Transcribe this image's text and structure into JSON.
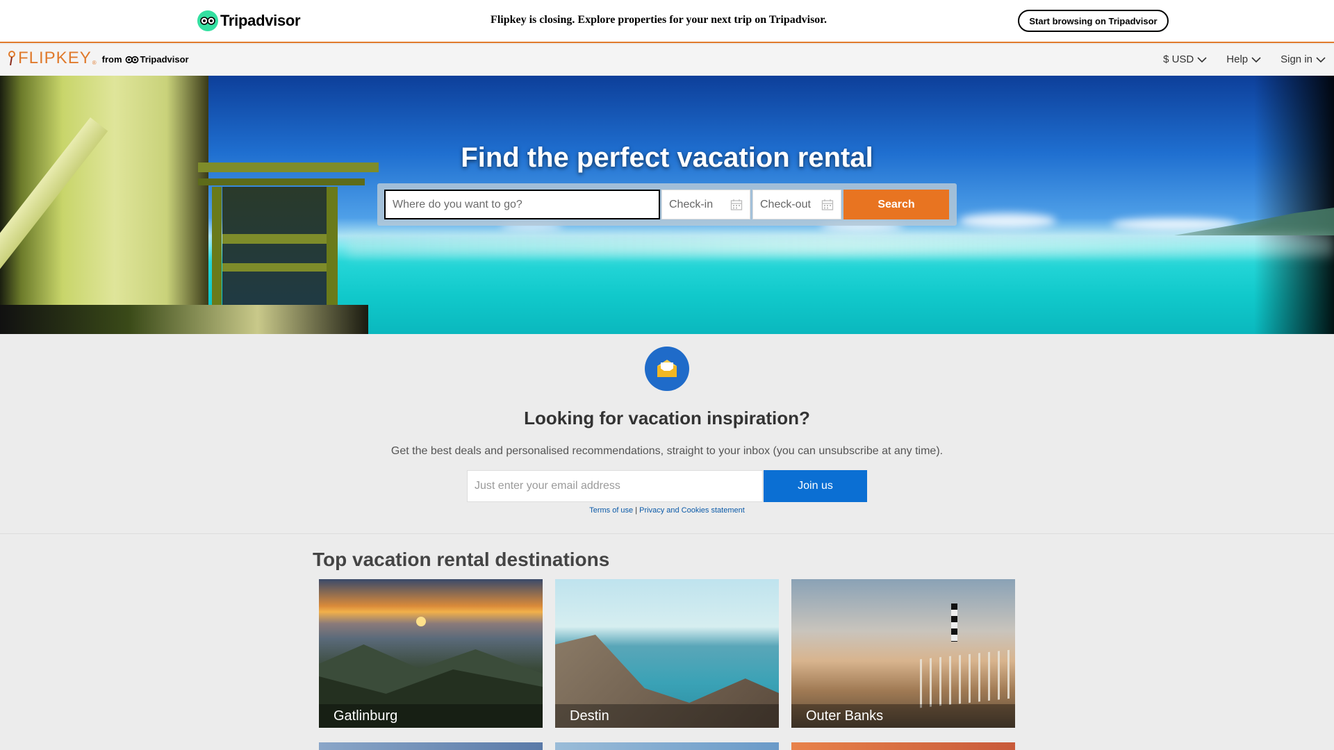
{
  "tripadvisor_banner": {
    "logo_text": "Tripadvisor",
    "message": "Flipkey is closing. Explore properties for your next trip on Tripadvisor.",
    "cta_label": "Start browsing on Tripadvisor"
  },
  "nav": {
    "logo_text": "FLIPKEY",
    "logo_reg": "®",
    "from_text": "from",
    "from_brand": "Tripadvisor",
    "menu": [
      {
        "label": "$ USD"
      },
      {
        "label": "Help"
      },
      {
        "label": "Sign in"
      }
    ]
  },
  "hero": {
    "title": "Find the perfect vacation rental",
    "where_placeholder": "Where do you want to go?",
    "checkin_label": "Check-in",
    "checkout_label": "Check-out",
    "search_label": "Search"
  },
  "newsletter": {
    "title": "Looking for vacation inspiration?",
    "subtitle": "Get the best deals and personalised recommendations, straight to your inbox (you can unsubscribe at any time).",
    "email_placeholder": "Just enter your email address",
    "join_label": "Join us",
    "terms_label": "Terms of use",
    "separator": "|",
    "privacy_label": "Privacy and Cookies statement"
  },
  "destinations": {
    "title": "Top vacation rental destinations",
    "items": [
      {
        "name": "Gatlinburg"
      },
      {
        "name": "Destin"
      },
      {
        "name": "Outer Banks"
      }
    ]
  },
  "colors": {
    "accent_orange": "#e87421",
    "join_blue": "#0b6fd3",
    "tripadvisor_green": "#34e0a1"
  }
}
